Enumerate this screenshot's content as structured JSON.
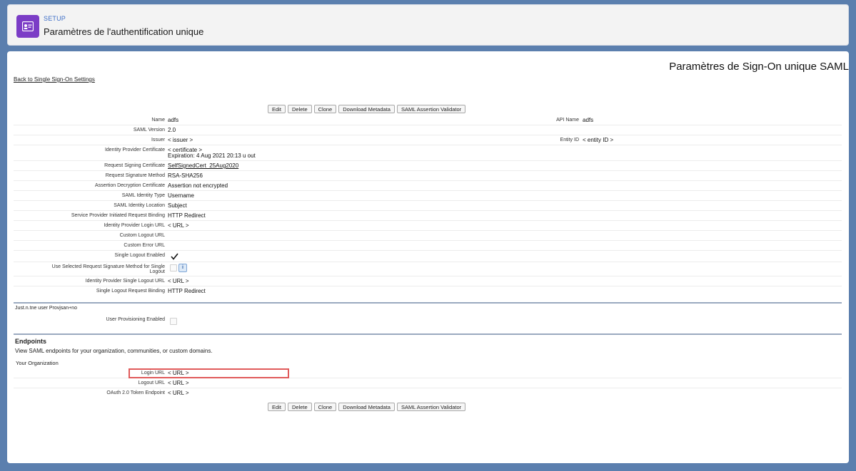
{
  "header": {
    "section": "SETUP",
    "title": "Paramètres de l'authentification unique"
  },
  "page": {
    "heading": "Paramètres de Sign-On unique SAML",
    "back_link": "Back to Single Sign-On Settings"
  },
  "buttons": [
    "Edit",
    "Delete",
    "Clone",
    "Download Metadata",
    "SAML Assertion Validator"
  ],
  "details": {
    "name_label": "Name",
    "name_value": "adfs",
    "api_name_label": "API Name",
    "api_name_value": "adfs",
    "saml_version_label": "SAML Version",
    "saml_version_value": "2.0",
    "issuer_label": "Issuer",
    "issuer_value": "< issuer >",
    "entity_id_label": "Entity ID",
    "entity_id_value": "< entity ID >",
    "idp_cert_label": "Identity Provider Certificate",
    "idp_cert_value1": "< certificate >",
    "idp_cert_value2": "Expiration: 4 Aug 2021 20:13 u out",
    "req_sign_cert_label": "Request Signing Certificate",
    "req_sign_cert_value": "SelfSignedCert_25Aug2020",
    "req_sig_method_label": "Request Signature Method",
    "req_sig_method_value": "RSA-SHA256",
    "assert_decrypt_label": "Assertion Decryption Certificate",
    "assert_decrypt_value": "Assertion not encrypted",
    "saml_id_type_label": "SAML Identity Type",
    "saml_id_type_value": "Username",
    "saml_id_loc_label": "SAML Identity Location",
    "saml_id_loc_value": "Subject",
    "sp_binding_label": "Service Provider Initiated Request Binding",
    "sp_binding_value": "HTTP Redirect",
    "idp_login_url_label": "Identity Provider Login URL",
    "idp_login_url_value": "< URL >",
    "custom_logout_label": "Custom Logout URL",
    "custom_error_label": "Custom Error URL",
    "single_logout_enabled_label": "Single Logout Enabled",
    "use_selected_label1": "Use Selected Request Signature Method for Single",
    "use_selected_label2": "Logout",
    "idp_single_logout_label": "Identity Provider Single Logout URL",
    "idp_single_logout_value": "< URL >",
    "single_logout_binding_label": "Single Logout Request Binding",
    "single_logout_binding_value": "HTTP Redirect"
  },
  "jit": {
    "title": "Just.n.tne user Provjsan+no",
    "user_prov_label": "User Provisioning Enabled"
  },
  "endpoints": {
    "title": "Endpoints",
    "description": "View SAML endpoints for your organization, communities, or custom domains.",
    "your_org": "Your Organization",
    "login_url_label": "Login URL",
    "login_url_value": "< URL >",
    "logout_url_label": "Logout URL",
    "logout_url_value": "< URL >",
    "oauth_label": "OAuth 2.0 Token Endpoint",
    "oauth_value": "< URL >"
  },
  "colors": {
    "background": "#5b7fae",
    "header_icon": "#7b3dc6",
    "highlight": "#e05a5a",
    "setup_label": "#3d6ec7"
  }
}
